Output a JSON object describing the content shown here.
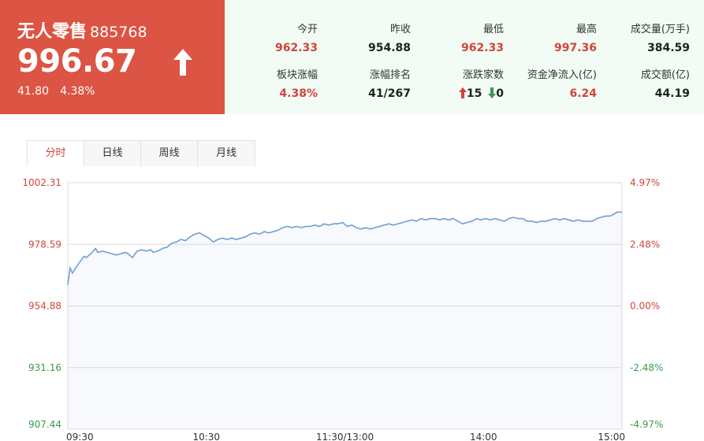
{
  "quote": {
    "name": "无人零售",
    "code": "885768",
    "price": "996.67",
    "change": "41.80",
    "change_pct": "4.38%",
    "direction_icon": "up-arrow-icon"
  },
  "stats": [
    {
      "label": "今开",
      "value": "962.33",
      "color": "red"
    },
    {
      "label": "昨收",
      "value": "954.88",
      "color": "dark"
    },
    {
      "label": "最低",
      "value": "962.33",
      "color": "red"
    },
    {
      "label": "最高",
      "value": "997.36",
      "color": "red"
    },
    {
      "label": "成交量(万手)",
      "value": "384.59",
      "color": "dark"
    },
    {
      "label": "板块涨幅",
      "value": "4.38%",
      "color": "red"
    },
    {
      "label": "涨幅排名",
      "value": "41/267",
      "color": "dark"
    },
    {
      "label": "涨跌家数",
      "up": "15",
      "down": "0"
    },
    {
      "label": "资金净流入(亿)",
      "value": "6.24",
      "color": "red"
    },
    {
      "label": "成交额(亿)",
      "value": "44.19",
      "color": "dark"
    }
  ],
  "tabs": [
    {
      "label": "分时",
      "active": true
    },
    {
      "label": "日线",
      "active": false
    },
    {
      "label": "周线",
      "active": false
    },
    {
      "label": "月线",
      "active": false
    }
  ],
  "colors": {
    "up": "#d0453b",
    "down": "#3c9a4c",
    "line": "#6f9fd0",
    "area": "#f7f9fd",
    "grid": "#d9d9d9"
  },
  "chart_data": {
    "type": "line",
    "x_ticks": [
      "09:30",
      "10:30",
      "11:30/13:00",
      "14:00",
      "15:00"
    ],
    "y_ticks_left": [
      "1002.31",
      "978.59",
      "954.88",
      "931.16",
      "907.44"
    ],
    "y_ticks_right": [
      "4.97%",
      "2.48%",
      "0.00%",
      "-2.48%",
      "-4.97%"
    ],
    "ylim": [
      907.44,
      1002.31
    ],
    "prev_close": 954.88,
    "x_range_minutes": [
      0,
      240
    ],
    "series": [
      {
        "values": [
          [
            0,
            963.0
          ],
          [
            1,
            969.5
          ],
          [
            2,
            967.5
          ],
          [
            3,
            969.0
          ],
          [
            5,
            971.5
          ],
          [
            7,
            974.0
          ],
          [
            8,
            973.5
          ],
          [
            10,
            975.0
          ],
          [
            12,
            977.0
          ],
          [
            13,
            975.5
          ],
          [
            15,
            976.0
          ],
          [
            17,
            975.5
          ],
          [
            19,
            975.0
          ],
          [
            21,
            974.5
          ],
          [
            23,
            975.0
          ],
          [
            25,
            975.5
          ],
          [
            26,
            975.0
          ],
          [
            28,
            973.5
          ],
          [
            30,
            976.0
          ],
          [
            32,
            976.5
          ],
          [
            34,
            976.0
          ],
          [
            36,
            976.5
          ],
          [
            37,
            975.5
          ],
          [
            39,
            976.0
          ],
          [
            41,
            977.0
          ],
          [
            43,
            977.5
          ],
          [
            45,
            979.0
          ],
          [
            47,
            979.5
          ],
          [
            49,
            980.5
          ],
          [
            51,
            980.0
          ],
          [
            53,
            981.5
          ],
          [
            55,
            982.5
          ],
          [
            57,
            983.0
          ],
          [
            59,
            982.0
          ],
          [
            61,
            981.0
          ],
          [
            63,
            979.5
          ],
          [
            65,
            980.5
          ],
          [
            67,
            981.0
          ],
          [
            69,
            980.5
          ],
          [
            71,
            981.0
          ],
          [
            73,
            980.5
          ],
          [
            75,
            981.0
          ],
          [
            77,
            981.5
          ],
          [
            79,
            982.5
          ],
          [
            81,
            983.0
          ],
          [
            83,
            982.5
          ],
          [
            85,
            983.5
          ],
          [
            87,
            983.0
          ],
          [
            89,
            983.5
          ],
          [
            91,
            984.0
          ],
          [
            93,
            985.0
          ],
          [
            95,
            985.5
          ],
          [
            97,
            985.0
          ],
          [
            99,
            985.5
          ],
          [
            101,
            985.0
          ],
          [
            103,
            985.5
          ],
          [
            105,
            985.5
          ],
          [
            107,
            986.0
          ],
          [
            109,
            985.5
          ],
          [
            111,
            986.5
          ],
          [
            113,
            986.0
          ],
          [
            115,
            986.5
          ],
          [
            117,
            986.5
          ],
          [
            119,
            987.0
          ],
          [
            121,
            985.5
          ],
          [
            123,
            986.0
          ],
          [
            125,
            985.0
          ],
          [
            127,
            984.5
          ],
          [
            129,
            985.0
          ],
          [
            131,
            984.5
          ],
          [
            133,
            985.0
          ],
          [
            135,
            985.5
          ],
          [
            137,
            986.0
          ],
          [
            139,
            986.5
          ],
          [
            141,
            986.0
          ],
          [
            143,
            986.5
          ],
          [
            145,
            987.0
          ],
          [
            147,
            987.5
          ],
          [
            149,
            988.0
          ],
          [
            151,
            987.5
          ],
          [
            153,
            988.5
          ],
          [
            155,
            988.0
          ],
          [
            157,
            988.5
          ],
          [
            159,
            988.5
          ],
          [
            161,
            988.0
          ],
          [
            163,
            988.5
          ],
          [
            165,
            988.0
          ],
          [
            167,
            988.5
          ],
          [
            169,
            987.5
          ],
          [
            171,
            986.5
          ],
          [
            173,
            987.0
          ],
          [
            175,
            987.5
          ],
          [
            177,
            988.5
          ],
          [
            179,
            988.0
          ],
          [
            181,
            988.5
          ],
          [
            183,
            988.0
          ],
          [
            185,
            988.5
          ],
          [
            187,
            988.0
          ],
          [
            189,
            987.5
          ],
          [
            191,
            988.5
          ],
          [
            193,
            989.0
          ],
          [
            195,
            988.5
          ],
          [
            197,
            988.5
          ],
          [
            199,
            987.5
          ],
          [
            201,
            987.5
          ],
          [
            203,
            987.0
          ],
          [
            205,
            987.5
          ],
          [
            207,
            987.5
          ],
          [
            209,
            988.0
          ],
          [
            211,
            988.5
          ],
          [
            213,
            988.0
          ],
          [
            215,
            988.5
          ],
          [
            217,
            988.0
          ],
          [
            219,
            987.5
          ],
          [
            221,
            988.0
          ],
          [
            223,
            987.5
          ],
          [
            225,
            987.5
          ],
          [
            227,
            987.5
          ],
          [
            229,
            988.5
          ],
          [
            231,
            989.0
          ],
          [
            233,
            989.5
          ],
          [
            235,
            989.5
          ],
          [
            236,
            990.0
          ],
          [
            237,
            990.5
          ],
          [
            238,
            991.0
          ],
          [
            239,
            991.0
          ],
          [
            240,
            991.0
          ]
        ]
      }
    ]
  }
}
